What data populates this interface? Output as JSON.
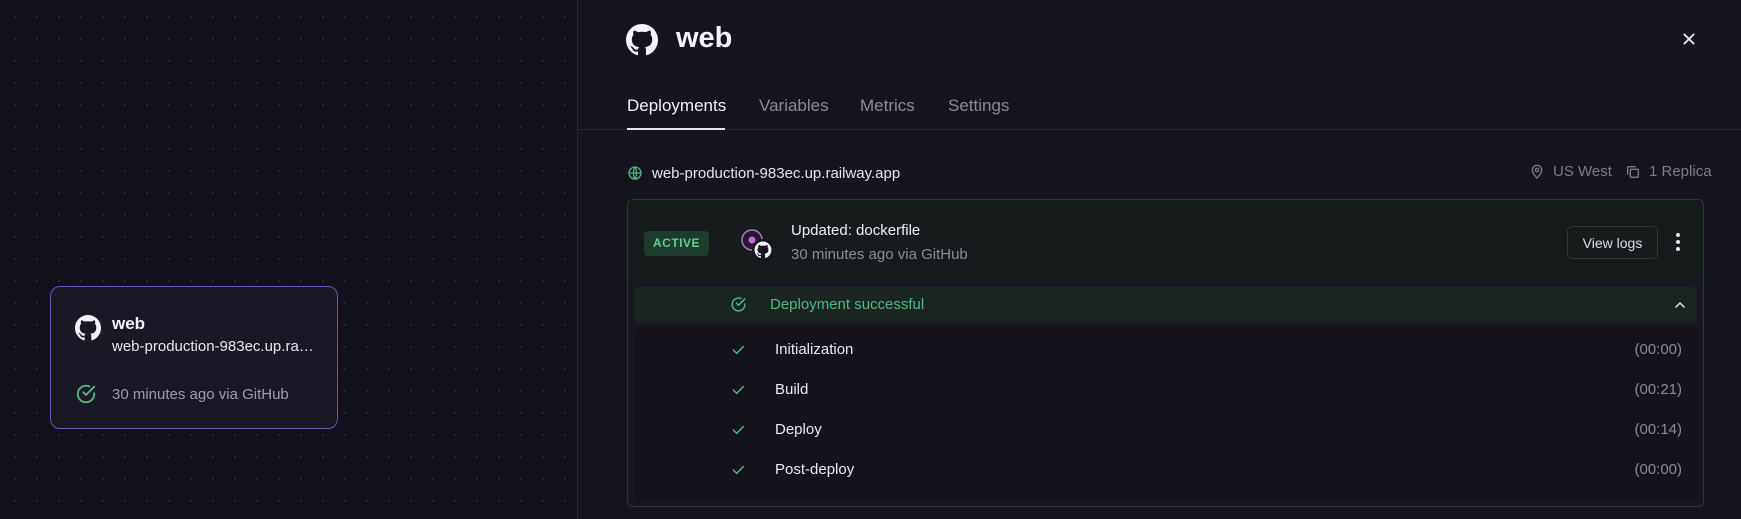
{
  "canvas": {
    "service_card": {
      "name": "web",
      "url": "web-production-983ec.up.railway.app",
      "status": "30 minutes ago via GitHub",
      "icon": "github-icon",
      "status_icon": "check-circle-icon"
    }
  },
  "panel": {
    "title": "web",
    "icon": "github-icon",
    "close_icon": "close-icon",
    "tabs": [
      {
        "label": "Deployments",
        "active": true
      },
      {
        "label": "Variables",
        "active": false
      },
      {
        "label": "Metrics",
        "active": false
      },
      {
        "label": "Settings",
        "active": false
      }
    ],
    "domain": "web-production-983ec.up.railway.app",
    "region": "US West",
    "replicas": "1 Replica"
  },
  "deployment": {
    "badge": "ACTIVE",
    "commit_message": "Updated: dockerfile",
    "commit_meta": "30 minutes ago via GitHub",
    "view_logs_label": "View logs",
    "status_label": "Deployment successful",
    "steps": [
      {
        "name": "Initialization",
        "duration": "(00:00)"
      },
      {
        "name": "Build",
        "duration": "(00:21)"
      },
      {
        "name": "Deploy",
        "duration": "(00:14)"
      },
      {
        "name": "Post-deploy",
        "duration": "(00:00)"
      }
    ]
  },
  "colors": {
    "background": "#13111c",
    "panel": "#16141f",
    "accent_purple": "#7c4dbf",
    "success_green": "#4fb97f",
    "active_badge_bg": "#1f3b2d"
  }
}
